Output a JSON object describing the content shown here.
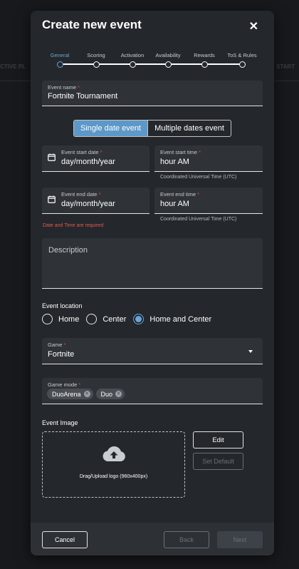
{
  "background": {
    "left_text": "CTIVE PL",
    "right_text": "START"
  },
  "modal": {
    "title": "Create new event"
  },
  "stepper": {
    "steps": [
      "General",
      "Scoring",
      "Activation",
      "Availability",
      "Rewards",
      "ToS & Rules"
    ],
    "active_index": 0
  },
  "event_name": {
    "label": "Event name",
    "value": "Fortnite Tournament"
  },
  "date_mode": {
    "single": "Single date event",
    "multiple": "Multiple dates event",
    "selected": "single"
  },
  "start": {
    "date_label": "Event start date",
    "date_value": "day/month/year",
    "time_label": "Event start time",
    "time_value": "hour AM",
    "tz_hint": "Coordinated Universal Time (UTC)"
  },
  "end": {
    "date_label": "Event end date",
    "date_value": "day/month/year",
    "time_label": "Event end time",
    "time_value": "hour AM",
    "tz_hint": "Coordinated Universal Time (UTC)"
  },
  "error_text": "Date and Time are required",
  "description": {
    "placeholder": "Description"
  },
  "location": {
    "label": "Event location",
    "options": [
      "Home",
      "Center",
      "Home and Center"
    ],
    "selected": "Home and Center"
  },
  "game": {
    "label": "Game",
    "value": "Fortnite"
  },
  "game_mode": {
    "label": "Game mode",
    "chips": [
      "DuoArena",
      "Duo"
    ]
  },
  "event_image": {
    "label": "Event Image",
    "upload_text": "Drag/Upload logo (960x400px)",
    "edit_label": "Edit",
    "set_default_label": "Set Default"
  },
  "footer": {
    "cancel_label": "Cancel",
    "back_label": "Back",
    "next_label": "Next"
  },
  "colors": {
    "accent": "#6aa6d8",
    "toggle_active": "#5d98c8",
    "required": "#e04545",
    "error": "#e25b4b",
    "modal_bg": "#24272b",
    "field_bg": "#2f3338"
  }
}
